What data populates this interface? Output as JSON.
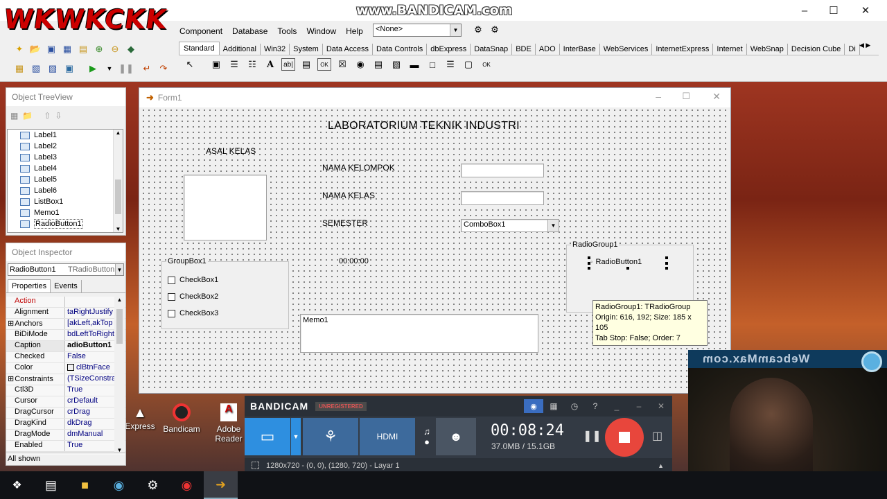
{
  "watermarks": {
    "wkwk": "WKWKCKK",
    "bandicam": "www.BANDICAM.com"
  },
  "menubar": {
    "items": [
      "Component",
      "Database",
      "Tools",
      "Window",
      "Help"
    ]
  },
  "object_combo": {
    "value": "<None>"
  },
  "palette": {
    "tabs": [
      "Standard",
      "Additional",
      "Win32",
      "System",
      "Data Access",
      "Data Controls",
      "dbExpress",
      "DataSnap",
      "BDE",
      "ADO",
      "InterBase",
      "WebServices",
      "InternetExpress",
      "Internet",
      "WebSnap",
      "Decision Cube",
      "Di"
    ]
  },
  "treeview": {
    "title": "Object TreeView",
    "items": [
      "Label1",
      "Label2",
      "Label3",
      "Label4",
      "Label5",
      "Label6",
      "ListBox1",
      "Memo1",
      "RadioButton1"
    ],
    "selected": "RadioButton1"
  },
  "inspector": {
    "title": "Object Inspector",
    "object_name": "RadioButton1",
    "object_type": "TRadioButton",
    "tabs": [
      "Properties",
      "Events"
    ],
    "properties": [
      {
        "name": "Action",
        "value": "",
        "red": true
      },
      {
        "name": "Alignment",
        "value": "taRightJustify"
      },
      {
        "name": "Anchors",
        "value": "[akLeft,akTop",
        "plus": true
      },
      {
        "name": "BiDiMode",
        "value": "bdLeftToRight"
      },
      {
        "name": "Caption",
        "value": "adioButton1",
        "selected": true
      },
      {
        "name": "Checked",
        "value": "False"
      },
      {
        "name": "Color",
        "value": "clBtnFace",
        "swatch": true
      },
      {
        "name": "Constraints",
        "value": "(TSizeConstra",
        "plus": true
      },
      {
        "name": "Ctl3D",
        "value": "True"
      },
      {
        "name": "Cursor",
        "value": "crDefault"
      },
      {
        "name": "DragCursor",
        "value": "crDrag"
      },
      {
        "name": "DragKind",
        "value": "dkDrag"
      },
      {
        "name": "DragMode",
        "value": "dmManual"
      },
      {
        "name": "Enabled",
        "value": "True"
      }
    ],
    "status": "All shown"
  },
  "form": {
    "title": "Form1",
    "heading": "LABORATORIUM TEKNIK INDUSTRI",
    "label_asal_kelas": "ASAL KELAS",
    "label_nama_kelompok": "NAMA KELOMPOK",
    "label_nama_kelas": "NAMA KELAS",
    "label_semester": "SEMESTER",
    "combo_value": "ComboBox1",
    "time_label": "00:00:00",
    "groupbox_caption": "GroupBox1",
    "checkboxes": [
      "CheckBox1",
      "CheckBox2",
      "CheckBox3"
    ],
    "memo_text": "Memo1",
    "radiogroup_caption": "RadioGroup1",
    "radiobutton_caption": "RadioButton1",
    "hint_lines": [
      "RadioGroup1: TRadioGroup",
      "Origin: 616, 192; Size: 185 x 105",
      "Tab Stop: False; Order: 7"
    ]
  },
  "desktop_icons": [
    "Express",
    "Bandicam",
    "Adobe Reader"
  ],
  "bandicam": {
    "brand": "BANDICAM",
    "badge": "UNREGISTERED",
    "timer": "00:08:24",
    "size": "37.0MB / 15.1GB",
    "status": "1280x720 - (0, 0), (1280, 720) - Layar 1"
  },
  "webcam": {
    "overlay": "WebcamMax.com"
  }
}
